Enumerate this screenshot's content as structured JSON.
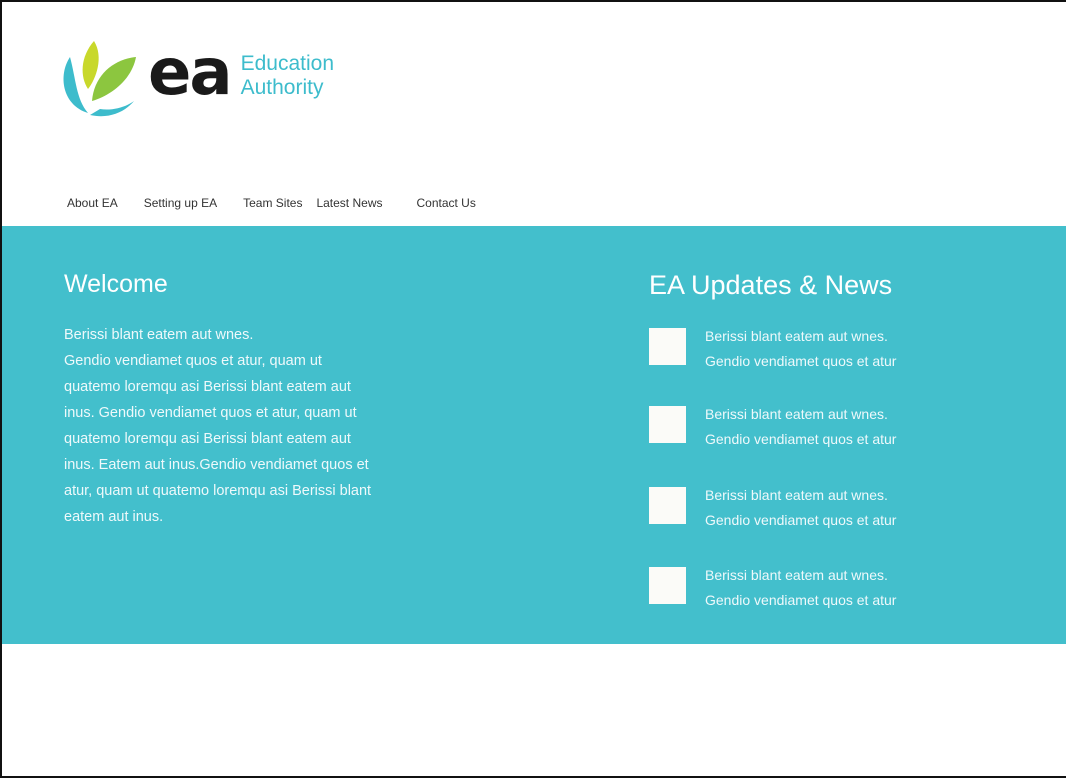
{
  "logo": {
    "letters": "ea",
    "tag_line1": "Education",
    "tag_line2": "Authority",
    "colors": {
      "green": "#8cc63f",
      "lime": "#c8d82b",
      "teal": "#3dbccc"
    }
  },
  "nav": {
    "items": [
      {
        "label": "About EA"
      },
      {
        "label": "Setting up EA"
      },
      {
        "label": "Team Sites"
      },
      {
        "label": "Latest News"
      },
      {
        "label": "Contact Us"
      }
    ]
  },
  "theme": {
    "band_color": "#43bfcc",
    "text_color": "#ffffff"
  },
  "welcome": {
    "title": "Welcome",
    "lines": [
      "Berissi blant eatem aut wnes.",
      "Gendio vendiamet quos et atur, quam ut",
      "quatemo loremqu asi Berissi blant eatem aut",
      "inus. Gendio vendiamet quos et atur, quam ut",
      "quatemo loremqu asi Berissi blant eatem aut",
      "inus. Eatem aut inus.Gendio vendiamet quos et",
      "atur, quam ut quatemo loremqu asi Berissi blant",
      "eatem aut inus."
    ]
  },
  "news": {
    "title": "EA Updates & News",
    "items": [
      {
        "line1": "Berissi blant eatem aut wnes.",
        "line2": "Gendio vendiamet quos et atur"
      },
      {
        "line1": "Berissi blant eatem aut wnes.",
        "line2": "Gendio vendiamet quos et atur"
      },
      {
        "line1": "Berissi blant eatem aut wnes.",
        "line2": "Gendio vendiamet quos et atur"
      },
      {
        "line1": "Berissi blant eatem aut wnes.",
        "line2": "Gendio vendiamet quos et atur"
      }
    ]
  }
}
